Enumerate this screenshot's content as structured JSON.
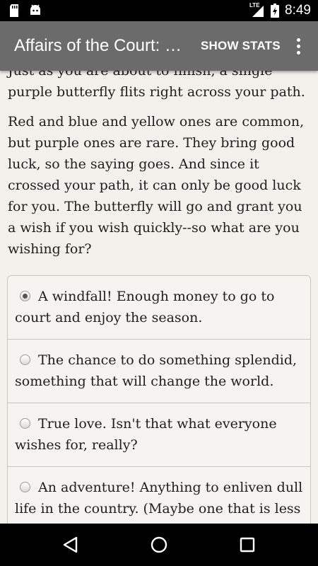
{
  "status_bar": {
    "time": "8:49",
    "network": "LTE",
    "icons": [
      "sd-card-icon",
      "android-icon",
      "signal-icon",
      "battery-charging-icon"
    ]
  },
  "app_bar": {
    "title": "Affairs of the Court: Choice of Romance",
    "show_stats_label": "SHOW STATS",
    "menu_icon": "overflow-menu-icon"
  },
  "story": {
    "partial_top": "Just as you are about to finish, a single purple butterfly flits right across your path.",
    "paragraph": "Red and blue and yellow ones are common, but purple ones are rare. They bring good luck, so the saying goes. And since it crossed your path, it can only be good luck for you. The butterfly will go and grant you a wish if you wish quickly--so what are you wishing for?"
  },
  "choices": [
    {
      "label": "A windfall! Enough money to go to court and enjoy the season.",
      "selected": true
    },
    {
      "label": "The chance to do something splendid, something that will change the world.",
      "selected": false
    },
    {
      "label": "True love. Isn't that what everyone wishes for, really?",
      "selected": false
    },
    {
      "label": "An adventure! Anything to enliven dull life in the country. (Maybe one that is less",
      "selected": false
    }
  ],
  "nav_bar": {
    "icons": [
      "back-icon",
      "home-icon",
      "recents-icon"
    ]
  },
  "colors": {
    "app_bar": "#6b6b6b",
    "background": "#f4f1ec",
    "text": "#1e1e1e",
    "border": "#c9c6c2"
  }
}
